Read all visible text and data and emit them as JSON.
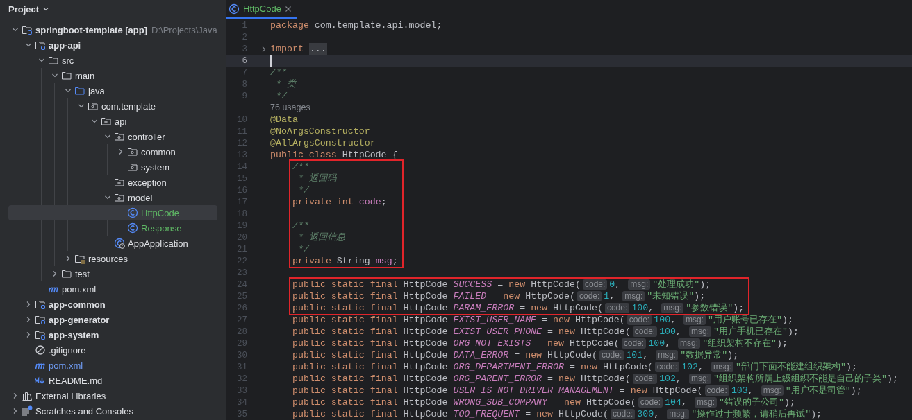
{
  "panel": {
    "title": "Project"
  },
  "tree": [
    {
      "label": "springboot-template **[app]**",
      "path": "D:\\Projects\\Java",
      "kind": "module",
      "expanded": true,
      "selected": false,
      "children": [
        {
          "label": "app-api",
          "kind": "module",
          "expanded": true,
          "selected": false,
          "children": [
            {
              "label": "src",
              "kind": "folder",
              "expanded": true,
              "selected": false,
              "children": [
                {
                  "label": "main",
                  "kind": "folder",
                  "expanded": true,
                  "selected": false,
                  "children": [
                    {
                      "label": "java",
                      "kind": "source",
                      "expanded": true,
                      "selected": false,
                      "children": [
                        {
                          "label": "com.template",
                          "kind": "package",
                          "expanded": true,
                          "selected": false,
                          "children": [
                            {
                              "label": "api",
                              "kind": "package",
                              "expanded": true,
                              "selected": false,
                              "children": [
                                {
                                  "label": "controller",
                                  "kind": "package",
                                  "expanded": true,
                                  "selected": false,
                                  "children": [
                                    {
                                      "label": "common",
                                      "kind": "package",
                                      "expanded": false,
                                      "selected": false
                                    },
                                    {
                                      "label": "system",
                                      "kind": "package",
                                      "selected": false
                                    }
                                  ]
                                },
                                {
                                  "label": "exception",
                                  "kind": "package",
                                  "selected": false
                                },
                                {
                                  "label": "model",
                                  "kind": "package",
                                  "expanded": true,
                                  "selected": false,
                                  "children": [
                                    {
                                      "label": "HttpCode",
                                      "kind": "class",
                                      "color": "#5fb865",
                                      "selected": true
                                    },
                                    {
                                      "label": "Response",
                                      "kind": "class",
                                      "color": "#5fb865",
                                      "selected": false
                                    }
                                  ]
                                },
                                {
                                  "label": "AppApplication",
                                  "kind": "app",
                                  "selected": false
                                }
                              ]
                            }
                          ]
                        }
                      ]
                    },
                    {
                      "label": "resources",
                      "kind": "resources",
                      "expanded": false,
                      "selected": false
                    }
                  ]
                },
                {
                  "label": "test",
                  "kind": "folder",
                  "expanded": false,
                  "selected": false
                }
              ]
            },
            {
              "label": "pom.xml",
              "kind": "maven",
              "selected": false
            }
          ]
        },
        {
          "label": "app-common",
          "kind": "module",
          "expanded": false,
          "selected": false
        },
        {
          "label": "app-generator",
          "kind": "module",
          "expanded": false,
          "selected": false
        },
        {
          "label": "app-system",
          "kind": "module",
          "expanded": false,
          "selected": false
        },
        {
          "label": ".gitignore",
          "kind": "gitignore",
          "selected": false
        },
        {
          "label": "pom.xml",
          "kind": "maven",
          "color": "#6f9bf2",
          "selected": false
        },
        {
          "label": "README.md",
          "kind": "markdown",
          "selected": false
        }
      ]
    },
    {
      "label": "External Libraries",
      "kind": "libraries",
      "expanded": false,
      "selected": false
    },
    {
      "label": "Scratches and Consoles",
      "kind": "scratches",
      "expanded": false,
      "selected": false
    }
  ],
  "editor": {
    "tabs": [
      {
        "label": "HttpCode",
        "color": "#5fb865",
        "selected": true
      }
    ],
    "sections": [
      {
        "indented": false,
        "boxed": false,
        "lines": [
          {
            "number": "1",
            "current": false,
            "tokens": [
              {
                "kind": "keyword",
                "text": "package"
              },
              {
                "kind": "plain",
                "text": " com.template.api.model;"
              }
            ]
          },
          {
            "number": "2",
            "current": false
          },
          {
            "number": "3",
            "current": false,
            "folded": true,
            "tokens": [
              {
                "kind": "keyword",
                "text": "import"
              },
              {
                "kind": "folded",
                "text": "..."
              }
            ]
          },
          {
            "number": "6",
            "current": true
          },
          {
            "number": "7",
            "current": false,
            "tokens": [
              {
                "kind": "doc",
                "text": "/**"
              }
            ]
          },
          {
            "number": "8",
            "current": false,
            "tokens": [
              {
                "kind": "doc",
                "text": " * 类"
              }
            ]
          },
          {
            "number": "9",
            "current": false,
            "tokens": [
              {
                "kind": "doc",
                "text": " */"
              }
            ]
          },
          {
            "current": false,
            "tokens": [
              {
                "kind": "usages",
                "text": "76 usages"
              }
            ]
          },
          {
            "number": "10",
            "current": false,
            "tokens": [
              {
                "kind": "annotation",
                "text": "@Data"
              }
            ]
          },
          {
            "number": "11",
            "current": false,
            "tokens": [
              {
                "kind": "annotation",
                "text": "@NoArgsConstructor"
              }
            ]
          },
          {
            "number": "12",
            "current": false,
            "tokens": [
              {
                "kind": "annotation",
                "text": "@AllArgsConstructor"
              }
            ]
          },
          {
            "number": "13",
            "current": false,
            "tokens": [
              {
                "kind": "keyword",
                "text": "public class"
              },
              {
                "kind": "plain",
                "text": " HttpCode {"
              }
            ]
          }
        ]
      },
      {
        "indented": true,
        "boxed": true,
        "lines": [
          {
            "number": "14",
            "current": false,
            "tokens": [
              {
                "kind": "doc",
                "text": "/**"
              }
            ]
          },
          {
            "number": "15",
            "current": false,
            "tokens": [
              {
                "kind": "doc",
                "text": " * 返回码"
              }
            ]
          },
          {
            "number": "16",
            "current": false,
            "tokens": [
              {
                "kind": "doc",
                "text": " */"
              }
            ]
          },
          {
            "number": "17",
            "current": false,
            "tokens": [
              {
                "kind": "keyword",
                "text": "private int"
              },
              {
                "kind": "field",
                "text": " code"
              },
              {
                "kind": "plain",
                "text": ";"
              }
            ]
          },
          {
            "number": "18",
            "current": false
          },
          {
            "number": "19",
            "current": false,
            "tokens": [
              {
                "kind": "doc",
                "text": "/**"
              }
            ]
          },
          {
            "number": "20",
            "current": false,
            "tokens": [
              {
                "kind": "doc",
                "text": " * 返回信息"
              }
            ]
          },
          {
            "number": "21",
            "current": false,
            "tokens": [
              {
                "kind": "doc",
                "text": " */"
              }
            ]
          },
          {
            "number": "22",
            "current": false,
            "tokens": [
              {
                "kind": "keyword",
                "text": "private"
              },
              {
                "kind": "plain",
                "text": " String "
              },
              {
                "kind": "field",
                "text": "msg"
              },
              {
                "kind": "plain",
                "text": ";"
              }
            ]
          }
        ]
      },
      {
        "indented": true,
        "boxed": false,
        "lines": [
          {
            "number": "23",
            "current": false
          }
        ]
      },
      {
        "indented": true,
        "boxed": true,
        "lines": [
          {
            "number": "24",
            "current": false,
            "tokens": [
              {
                "kind": "keyword",
                "text": "public static final"
              },
              {
                "kind": "plain",
                "text": " HttpCode "
              },
              {
                "kind": "constant",
                "text": "SUCCESS"
              },
              {
                "kind": "plain",
                "text": " = "
              },
              {
                "kind": "keyword",
                "text": "new"
              },
              {
                "kind": "plain",
                "text": " HttpCode("
              },
              {
                "kind": "hint",
                "text": "code:"
              },
              {
                "kind": "number",
                "text": "0"
              },
              {
                "kind": "plain",
                "text": ", "
              },
              {
                "kind": "hint",
                "text": "msg:"
              },
              {
                "kind": "string",
                "text": "\"处理成功\""
              },
              {
                "kind": "plain",
                "text": ");"
              }
            ]
          },
          {
            "number": "25",
            "current": false,
            "tokens": [
              {
                "kind": "keyword",
                "text": "public static final"
              },
              {
                "kind": "plain",
                "text": " HttpCode "
              },
              {
                "kind": "constant",
                "text": "FAILED"
              },
              {
                "kind": "plain",
                "text": " = "
              },
              {
                "kind": "keyword",
                "text": "new"
              },
              {
                "kind": "plain",
                "text": " HttpCode("
              },
              {
                "kind": "hint",
                "text": "code:"
              },
              {
                "kind": "number",
                "text": "1"
              },
              {
                "kind": "plain",
                "text": ", "
              },
              {
                "kind": "hint",
                "text": "msg:"
              },
              {
                "kind": "string",
                "text": "\"未知错误\""
              },
              {
                "kind": "plain",
                "text": ");"
              }
            ]
          },
          {
            "number": "26",
            "current": false,
            "tokens": [
              {
                "kind": "keyword",
                "text": "public static final"
              },
              {
                "kind": "plain",
                "text": " HttpCode "
              },
              {
                "kind": "constant",
                "text": "PARAM_ERROR"
              },
              {
                "kind": "plain",
                "text": " = "
              },
              {
                "kind": "keyword",
                "text": "new"
              },
              {
                "kind": "plain",
                "text": " HttpCode("
              },
              {
                "kind": "hint",
                "text": "code:"
              },
              {
                "kind": "number",
                "text": "100"
              },
              {
                "kind": "plain",
                "text": ", "
              },
              {
                "kind": "hint",
                "text": "msg:"
              },
              {
                "kind": "string",
                "text": "\"参数错误\""
              },
              {
                "kind": "plain",
                "text": ");"
              }
            ]
          }
        ]
      },
      {
        "indented": true,
        "boxed": false,
        "lines": [
          {
            "number": "27",
            "current": false,
            "tokens": [
              {
                "kind": "keyword",
                "text": "public static final"
              },
              {
                "kind": "plain",
                "text": " HttpCode "
              },
              {
                "kind": "constant",
                "text": "EXIST_USER_NAME"
              },
              {
                "kind": "plain",
                "text": " = "
              },
              {
                "kind": "keyword",
                "text": "new"
              },
              {
                "kind": "plain",
                "text": " HttpCode("
              },
              {
                "kind": "hint",
                "text": "code:"
              },
              {
                "kind": "number",
                "text": "100"
              },
              {
                "kind": "plain",
                "text": ", "
              },
              {
                "kind": "hint",
                "text": "msg:"
              },
              {
                "kind": "string",
                "text": "\"用户账号已存在\""
              },
              {
                "kind": "plain",
                "text": ");"
              }
            ]
          },
          {
            "number": "28",
            "current": false,
            "tokens": [
              {
                "kind": "keyword",
                "text": "public static final"
              },
              {
                "kind": "plain",
                "text": " HttpCode "
              },
              {
                "kind": "constant",
                "text": "EXIST_USER_PHONE"
              },
              {
                "kind": "plain",
                "text": " = "
              },
              {
                "kind": "keyword",
                "text": "new"
              },
              {
                "kind": "plain",
                "text": " HttpCode("
              },
              {
                "kind": "hint",
                "text": "code:"
              },
              {
                "kind": "number",
                "text": "100"
              },
              {
                "kind": "plain",
                "text": ", "
              },
              {
                "kind": "hint",
                "text": "msg:"
              },
              {
                "kind": "string",
                "text": "\"用户手机已存在\""
              },
              {
                "kind": "plain",
                "text": ");"
              }
            ]
          },
          {
            "number": "29",
            "current": false,
            "tokens": [
              {
                "kind": "keyword",
                "text": "public static final"
              },
              {
                "kind": "plain",
                "text": " HttpCode "
              },
              {
                "kind": "constant",
                "text": "ORG_NOT_EXISTS"
              },
              {
                "kind": "plain",
                "text": " = "
              },
              {
                "kind": "keyword",
                "text": "new"
              },
              {
                "kind": "plain",
                "text": " HttpCode("
              },
              {
                "kind": "hint",
                "text": "code:"
              },
              {
                "kind": "number",
                "text": "100"
              },
              {
                "kind": "plain",
                "text": ", "
              },
              {
                "kind": "hint",
                "text": "msg:"
              },
              {
                "kind": "string",
                "text": "\"组织架构不存在\""
              },
              {
                "kind": "plain",
                "text": ");"
              }
            ]
          },
          {
            "number": "30",
            "current": false,
            "tokens": [
              {
                "kind": "keyword",
                "text": "public static final"
              },
              {
                "kind": "plain",
                "text": " HttpCode "
              },
              {
                "kind": "constant",
                "text": "DATA_ERROR"
              },
              {
                "kind": "plain",
                "text": " = "
              },
              {
                "kind": "keyword",
                "text": "new"
              },
              {
                "kind": "plain",
                "text": " HttpCode("
              },
              {
                "kind": "hint",
                "text": "code:"
              },
              {
                "kind": "number",
                "text": "101"
              },
              {
                "kind": "plain",
                "text": ", "
              },
              {
                "kind": "hint",
                "text": "msg:"
              },
              {
                "kind": "string",
                "text": "\"数据异常\""
              },
              {
                "kind": "plain",
                "text": ");"
              }
            ]
          },
          {
            "number": "31",
            "current": false,
            "tokens": [
              {
                "kind": "keyword",
                "text": "public static final"
              },
              {
                "kind": "plain",
                "text": " HttpCode "
              },
              {
                "kind": "constant",
                "text": "ORG_DEPARTMENT_ERROR"
              },
              {
                "kind": "plain",
                "text": " = "
              },
              {
                "kind": "keyword",
                "text": "new"
              },
              {
                "kind": "plain",
                "text": " HttpCode("
              },
              {
                "kind": "hint",
                "text": "code:"
              },
              {
                "kind": "number",
                "text": "102"
              },
              {
                "kind": "plain",
                "text": ", "
              },
              {
                "kind": "hint",
                "text": "msg:"
              },
              {
                "kind": "string",
                "text": "\"部门下面不能建组织架构\""
              },
              {
                "kind": "plain",
                "text": ");"
              }
            ]
          },
          {
            "number": "32",
            "current": false,
            "tokens": [
              {
                "kind": "keyword",
                "text": "public static final"
              },
              {
                "kind": "plain",
                "text": " HttpCode "
              },
              {
                "kind": "constant",
                "text": "ORG_PARENT_ERROR"
              },
              {
                "kind": "plain",
                "text": " = "
              },
              {
                "kind": "keyword",
                "text": "new"
              },
              {
                "kind": "plain",
                "text": " HttpCode("
              },
              {
                "kind": "hint",
                "text": "code:"
              },
              {
                "kind": "number",
                "text": "102"
              },
              {
                "kind": "plain",
                "text": ", "
              },
              {
                "kind": "hint",
                "text": "msg:"
              },
              {
                "kind": "string",
                "text": "\"组织架构所属上级组织不能是自己的子类\""
              },
              {
                "kind": "plain",
                "text": ");"
              }
            ]
          },
          {
            "number": "33",
            "current": false,
            "tokens": [
              {
                "kind": "keyword",
                "text": "public static final"
              },
              {
                "kind": "plain",
                "text": " HttpCode "
              },
              {
                "kind": "constant",
                "text": "USER_IS_NOT_DRIVER_MANAGEMENT"
              },
              {
                "kind": "plain",
                "text": " = "
              },
              {
                "kind": "keyword",
                "text": "new"
              },
              {
                "kind": "plain",
                "text": " HttpCode("
              },
              {
                "kind": "hint",
                "text": "code:"
              },
              {
                "kind": "number",
                "text": "103"
              },
              {
                "kind": "plain",
                "text": ", "
              },
              {
                "kind": "hint",
                "text": "msg:"
              },
              {
                "kind": "string",
                "text": "\"用户不是司管\""
              },
              {
                "kind": "plain",
                "text": ");"
              }
            ]
          },
          {
            "number": "34",
            "current": false,
            "tokens": [
              {
                "kind": "keyword",
                "text": "public static final"
              },
              {
                "kind": "plain",
                "text": " HttpCode "
              },
              {
                "kind": "constant",
                "text": "WRONG_SUB_COMPANY"
              },
              {
                "kind": "plain",
                "text": " = "
              },
              {
                "kind": "keyword",
                "text": "new"
              },
              {
                "kind": "plain",
                "text": " HttpCode("
              },
              {
                "kind": "hint",
                "text": "code:"
              },
              {
                "kind": "number",
                "text": "104"
              },
              {
                "kind": "plain",
                "text": ", "
              },
              {
                "kind": "hint",
                "text": "msg:"
              },
              {
                "kind": "string",
                "text": "\"错误的子公司\""
              },
              {
                "kind": "plain",
                "text": ");"
              }
            ]
          },
          {
            "number": "35",
            "current": false,
            "tokens": [
              {
                "kind": "keyword",
                "text": "public static final"
              },
              {
                "kind": "plain",
                "text": " HttpCode "
              },
              {
                "kind": "constant",
                "text": "TOO_FREQUENT"
              },
              {
                "kind": "plain",
                "text": " = "
              },
              {
                "kind": "keyword",
                "text": "new"
              },
              {
                "kind": "plain",
                "text": " HttpCode("
              },
              {
                "kind": "hint",
                "text": "code:"
              },
              {
                "kind": "number",
                "text": "300"
              },
              {
                "kind": "plain",
                "text": ", "
              },
              {
                "kind": "hint",
                "text": "msg:"
              },
              {
                "kind": "string",
                "text": "\"操作过于频繁，请稍后再试\""
              },
              {
                "kind": "plain",
                "text": ");"
              }
            ]
          }
        ]
      }
    ]
  }
}
